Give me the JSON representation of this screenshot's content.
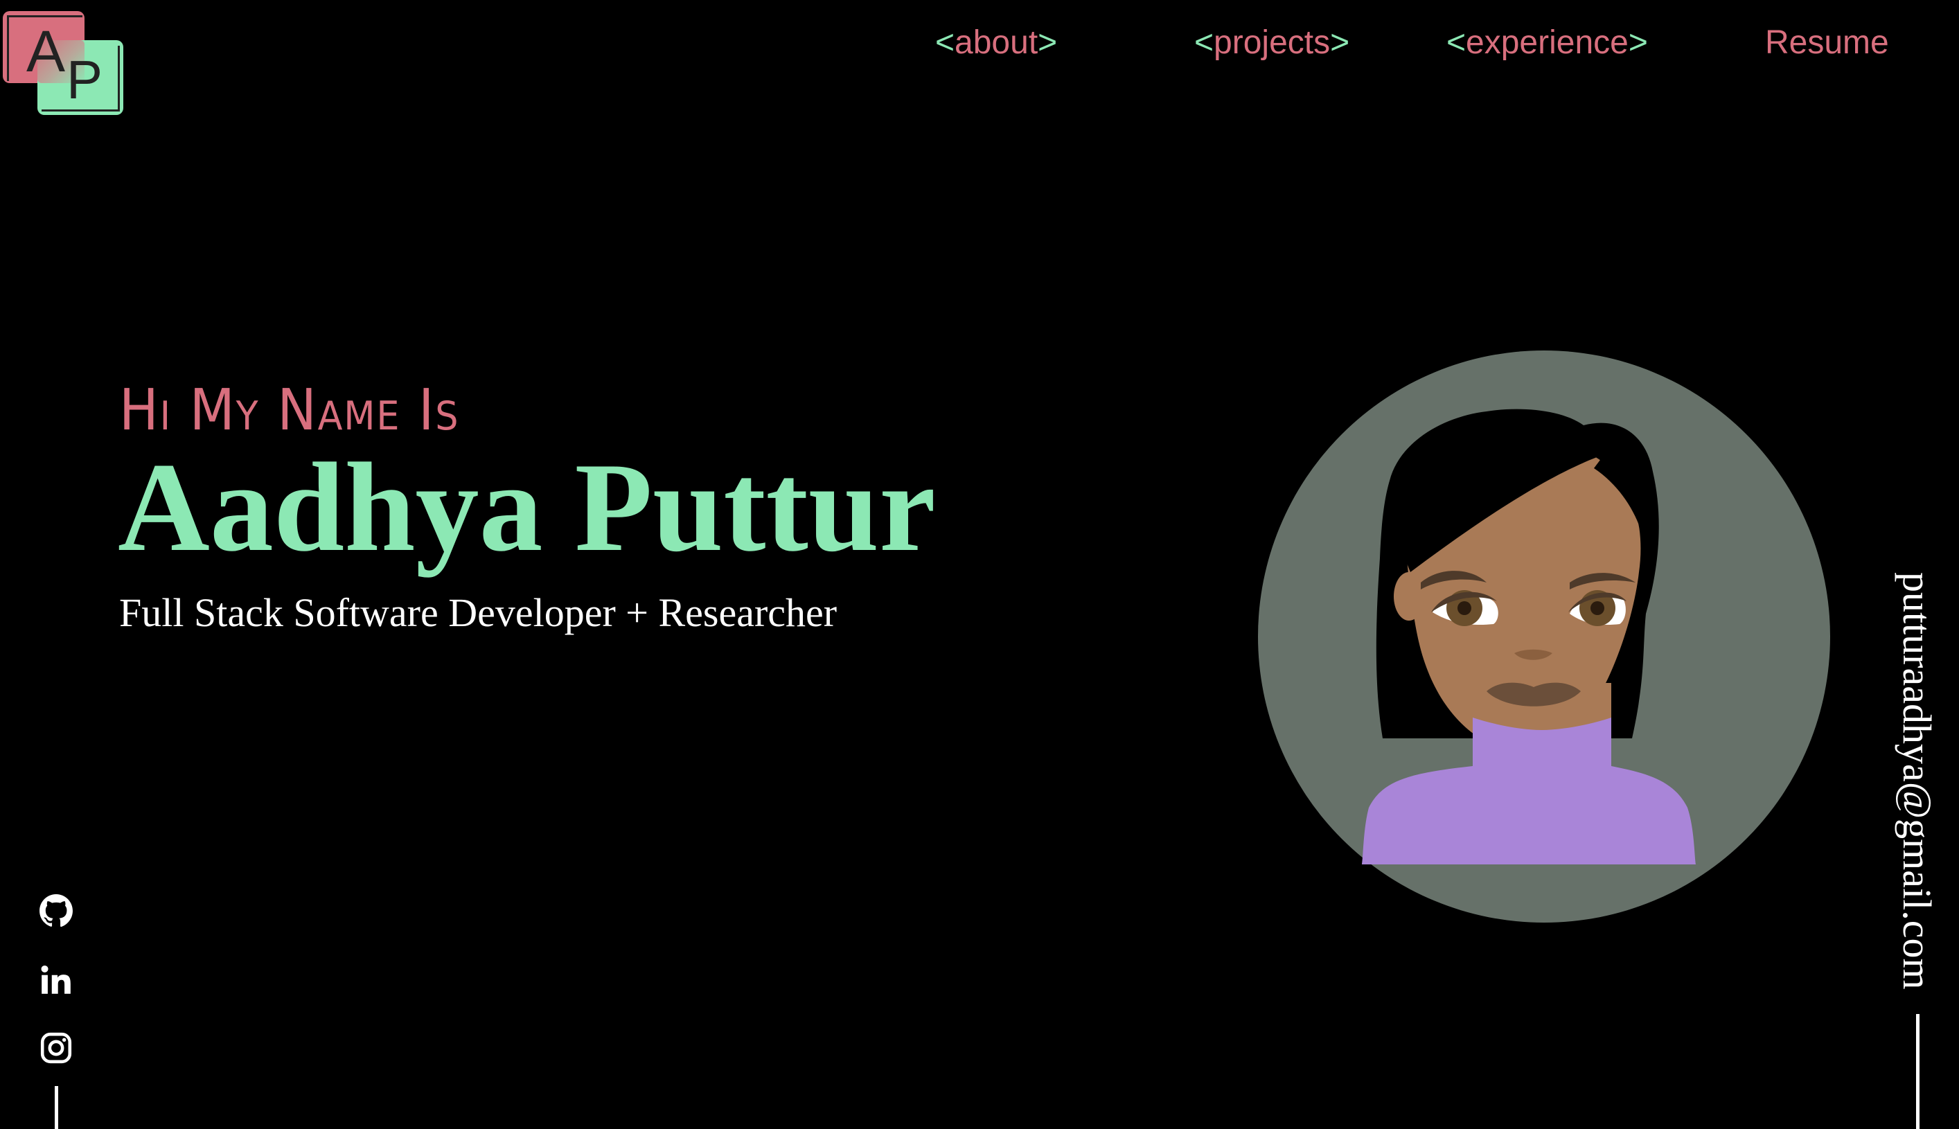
{
  "logo": {
    "letter_a": "A",
    "letter_p": "P"
  },
  "nav": {
    "items": [
      {
        "open": "<",
        "label": "about",
        "close": ">"
      },
      {
        "open": "<",
        "label": "projects",
        "close": ">"
      },
      {
        "open": "<",
        "label": "experience",
        "close": ">"
      }
    ],
    "resume": "Resume"
  },
  "hero": {
    "greeting": "Hi My Name Is",
    "name": "Aadhya Puttur",
    "tagline": "Full Stack Software Developer + Researcher"
  },
  "social": {
    "icons": [
      "github-icon",
      "linkedin-icon",
      "instagram-icon"
    ]
  },
  "contact": {
    "email": "putturaadhya@gmail.com"
  },
  "colors": {
    "background": "#000000",
    "accent_pink": "#d86f7e",
    "accent_green": "#8ce8b4",
    "text_white": "#ffffff",
    "avatar_bg": "#667169",
    "avatar_skin": "#a97a56",
    "avatar_top": "#a985d8"
  }
}
